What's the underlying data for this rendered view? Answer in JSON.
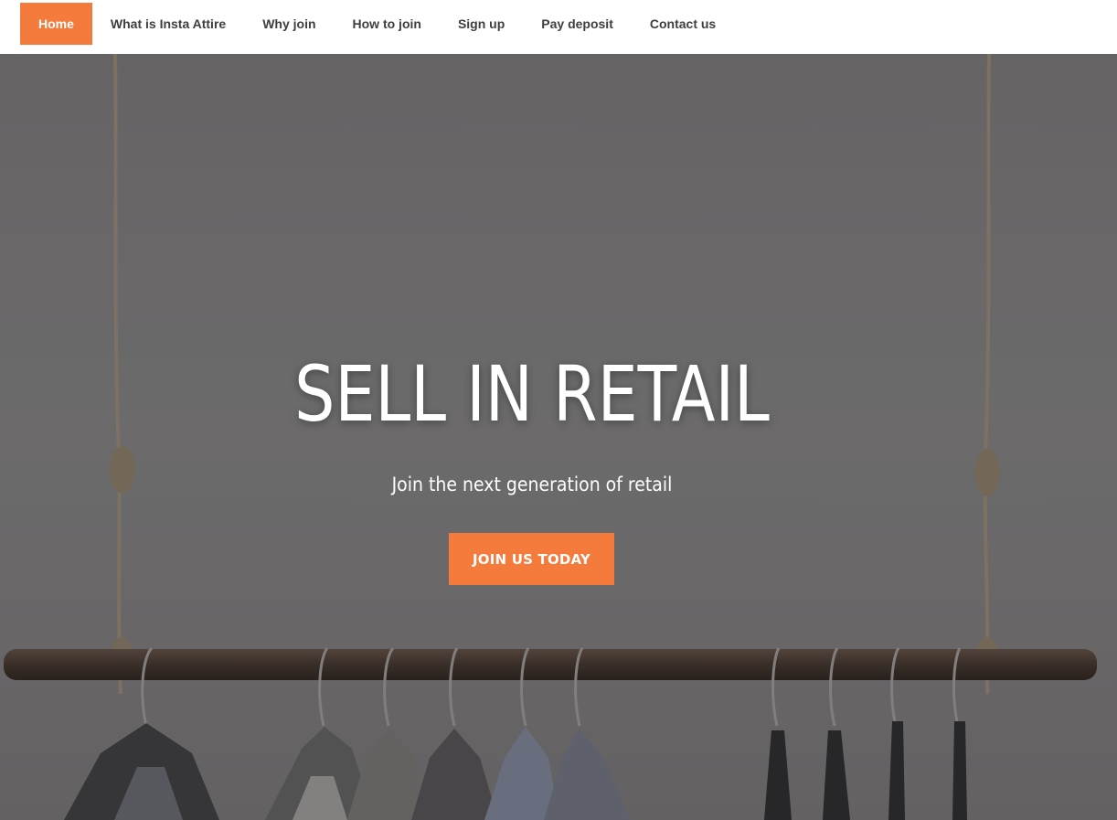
{
  "nav": {
    "items": [
      {
        "label": "Home",
        "active": true
      },
      {
        "label": "What is Insta Attire",
        "active": false
      },
      {
        "label": "Why join",
        "active": false
      },
      {
        "label": "How to join",
        "active": false
      },
      {
        "label": "Sign up",
        "active": false
      },
      {
        "label": "Pay deposit",
        "active": false
      },
      {
        "label": "Contact us",
        "active": false
      }
    ]
  },
  "hero": {
    "title": "SELL IN RETAIL",
    "subtitle": "Join the next generation of retail",
    "cta_label": "JOIN US TODAY"
  },
  "colors": {
    "accent": "#f47b3b",
    "nav_text": "#3e3e3e",
    "hero_overlay": "#727071"
  }
}
